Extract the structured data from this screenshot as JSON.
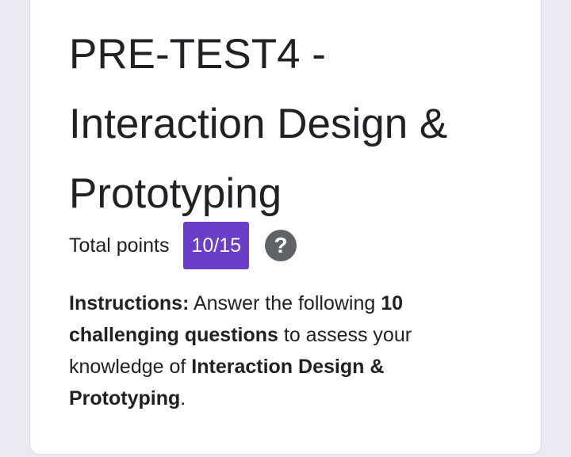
{
  "form": {
    "title": "PRE-TEST4 - Interaction Design & Prototyping",
    "points_label": "Total points",
    "points_value": "10/15",
    "help_icon": "help-question-icon",
    "help_symbol": "?"
  },
  "instructions": {
    "label": "Instructions:",
    "text_1": " Answer the following ",
    "bold_count": "10",
    "text_2": " ",
    "bold_questions": "challenging questions",
    "text_3": " to assess your knowledge of ",
    "bold_topic": "Interaction Design & Prototyping",
    "text_4": "."
  },
  "colors": {
    "background": "#ece9f5",
    "card": "#ffffff",
    "badge": "#6a3ec8",
    "help_icon": "#5f6368",
    "text": "#202124"
  }
}
